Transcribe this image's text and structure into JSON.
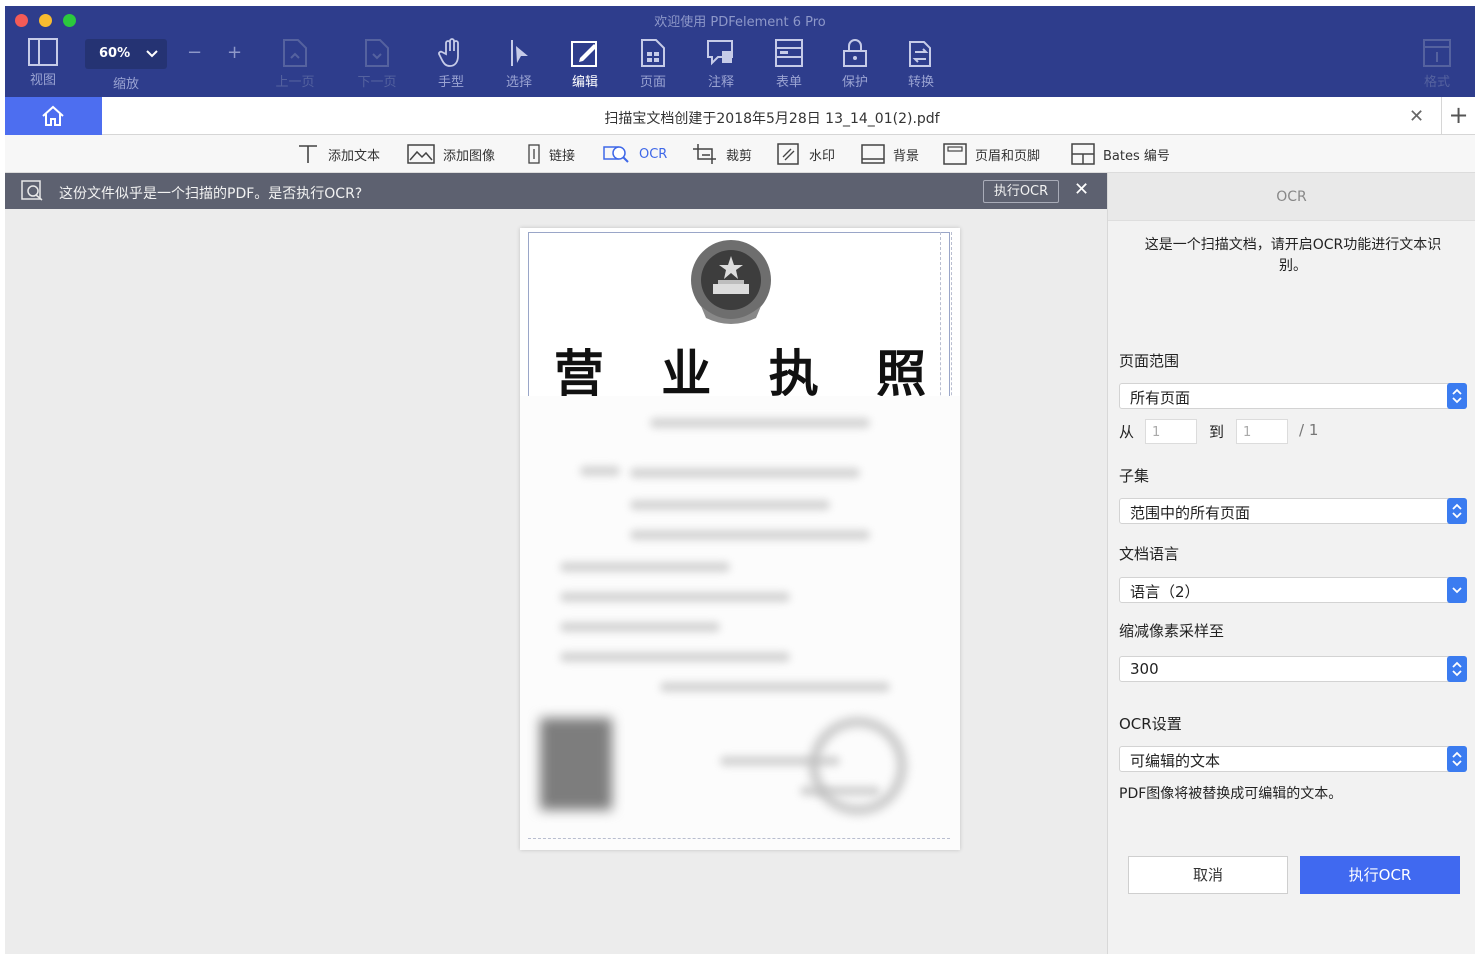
{
  "window": {
    "title": "欢迎使用 PDFelement 6 Pro"
  },
  "toolbar": {
    "view_label": "视图",
    "zoom_value": "60%",
    "zoom_label": "缩放",
    "zoom_out": "−",
    "zoom_in": "+",
    "prev_label": "上一页",
    "next_label": "下一页",
    "hand_label": "手型",
    "select_label": "选择",
    "edit_label": "编辑",
    "page_label": "页面",
    "comment_label": "注释",
    "form_label": "表单",
    "protect_label": "保护",
    "convert_label": "转换",
    "format_label": "格式"
  },
  "tabs": {
    "doc_title": "扫描宝文档创建于2018年5月28日 13_14_01(2).pdf",
    "close": "✕",
    "add": "+"
  },
  "edit_tools": [
    {
      "label": "添加文本",
      "icon": "text-icon"
    },
    {
      "label": "添加图像",
      "icon": "image-icon"
    },
    {
      "label": "链接",
      "icon": "link-icon"
    },
    {
      "label": "OCR",
      "icon": "ocr-icon"
    },
    {
      "label": "裁剪",
      "icon": "crop-icon"
    },
    {
      "label": "水印",
      "icon": "watermark-icon"
    },
    {
      "label": "背景",
      "icon": "background-icon"
    },
    {
      "label": "页眉和页脚",
      "icon": "header-footer-icon"
    },
    {
      "label": "Bates 编号",
      "icon": "bates-icon"
    }
  ],
  "banner": {
    "text": "这份文件似乎是一个扫描的PDF。是否执行OCR?",
    "button": "执行OCR",
    "close": "✕"
  },
  "document": {
    "title": "营 业 执 照"
  },
  "ocr_panel": {
    "title": "OCR",
    "description": "这是一个扫描文档，请开启OCR功能进行文本识别。",
    "page_range_label": "页面范围",
    "page_range_value": "所有页面",
    "from_label": "从",
    "from_value": "1",
    "to_label": "到",
    "to_value": "1",
    "total_pages": "/ 1",
    "subset_label": "子集",
    "subset_value": "范围中的所有页面",
    "language_label": "文档语言",
    "language_value": "语言（2）",
    "downsample_label": "缩减像素采样至",
    "downsample_value": "300",
    "ocr_settings_label": "OCR设置",
    "ocr_settings_value": "可编辑的文本",
    "hint": "PDF图像将被替换成可编辑的文本。",
    "cancel": "取消",
    "run": "执行OCR"
  },
  "colors": {
    "titlebar": "#2e3d8c",
    "accent": "#4069f0",
    "home_tab": "#4d6ef0",
    "banner": "#5d6170"
  }
}
